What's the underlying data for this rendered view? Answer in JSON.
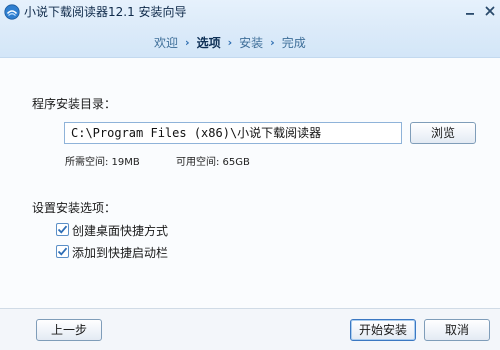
{
  "window": {
    "title": "小说下载阅读器12.1 安装向导",
    "minimize_icon": "minimize-icon",
    "close_icon": "close-icon"
  },
  "steps": {
    "items": [
      "欢迎",
      "选项",
      "安装",
      "完成"
    ],
    "active": "选项",
    "separator": "›"
  },
  "install_dir": {
    "label": "程序安装目录：",
    "path_value": "C:\\Program Files (x86)\\小说下载阅读器",
    "browse_label": "浏览",
    "required_space": "所需空间: 19MB",
    "available_space": "可用空间: 65GB"
  },
  "options": {
    "label": "设置安装选项：",
    "items": [
      {
        "label": "创建桌面快捷方式",
        "checked": true
      },
      {
        "label": "添加到快捷启动栏",
        "checked": true
      }
    ]
  },
  "footer": {
    "back_label": "上一步",
    "install_label": "开始安装",
    "cancel_label": "取消"
  },
  "colors": {
    "header_bg": "#dbeaf9",
    "accent": "#2b6cb0",
    "checkbox_check": "#2d6db5"
  }
}
